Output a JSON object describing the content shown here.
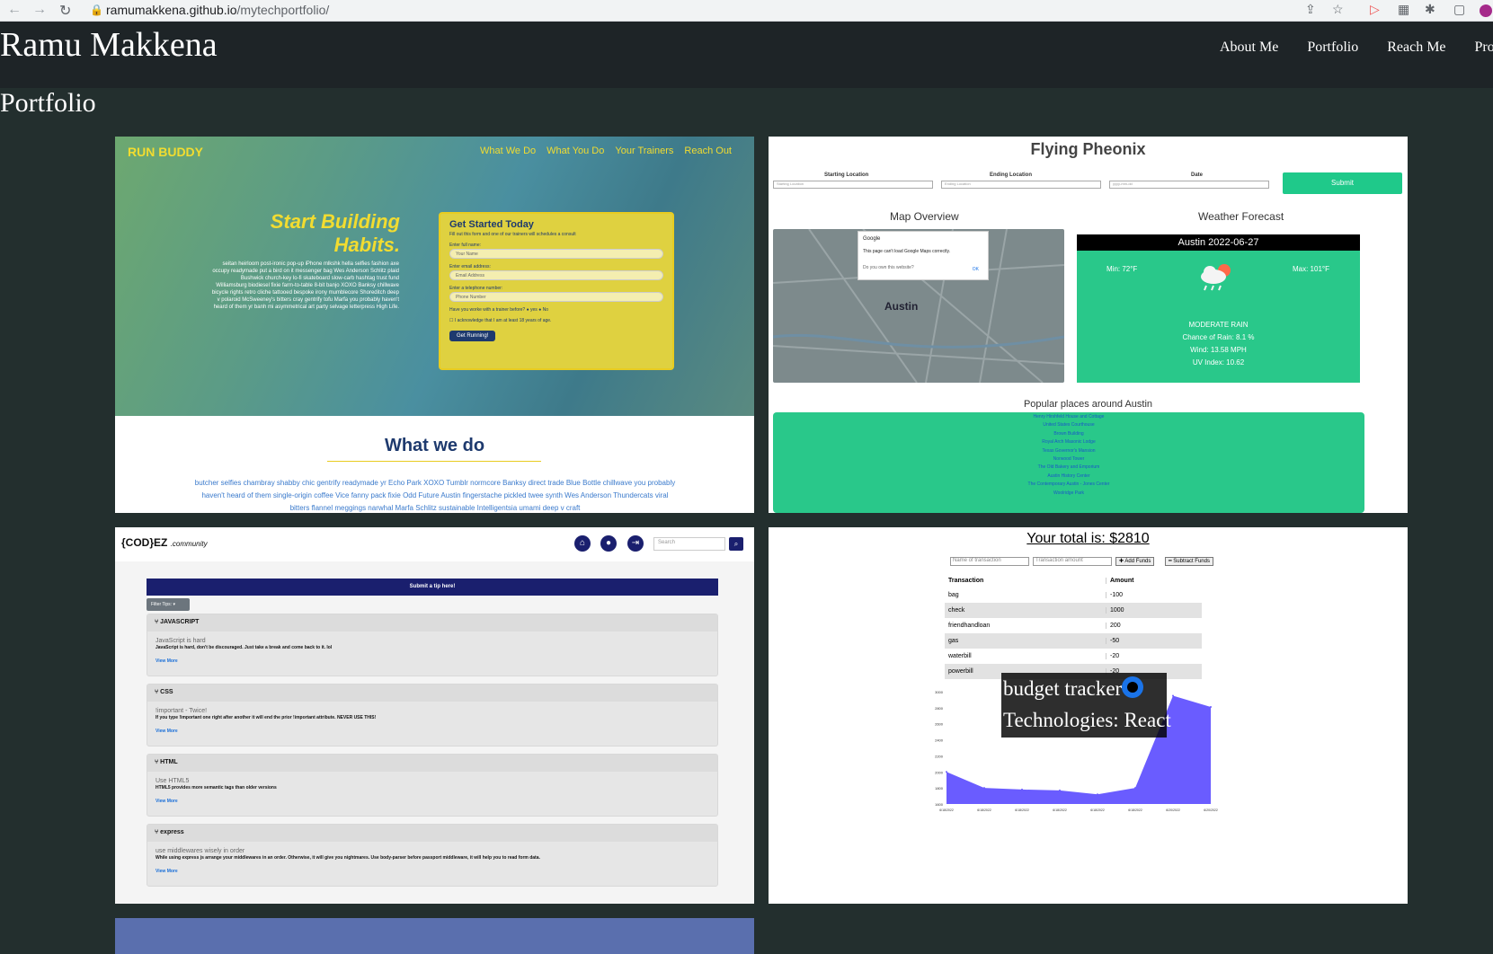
{
  "browser": {
    "url_host": "ramumakkena.github.io",
    "url_path": "/mytechportfolio/"
  },
  "header": {
    "brand": "Ramu Makkena",
    "nav": [
      "About Me",
      "Portfolio",
      "Reach Me",
      "Pro"
    ]
  },
  "section_title": "Portfolio",
  "run_buddy": {
    "logo": "RUN BUDDY",
    "nav": [
      "What We Do",
      "What You Do",
      "Your Trainers",
      "Reach Out"
    ],
    "hero_title_1": "Start Building",
    "hero_title_2": "Habits.",
    "hero_text": "seitan heirloom post-ironic pop-up iPhone mlkshk hella selfies fashion axe occupy readymade put a bird on it messenger bag Wes Anderson Schlitz plaid Bushwick church-key lo-fi skateboard slow-carb hashtag trust fund Williamsburg biodiesel fixie farm-to-table 8-bit banjo XOXO Banksy chillwave bicycle rights retro cliche tattooed bespoke irony mumblecore Shoreditch deep v polaroid McSweeney's bitters cray gentrify tofu Marfa you probably haven't heard of them yr banh mi asymmetrical art party selvage letterpress High Life.",
    "form_title": "Get Started Today",
    "form_sub": "Fill out this form and one of our trainers will schedules a consult",
    "label_name": "Enter full name:",
    "ph_name": "Your Name",
    "label_email": "Enter email address:",
    "ph_email": "Email Address",
    "label_phone": "Enter a telephone number:",
    "ph_phone": "Phone Number",
    "worked": "Have you worke with a trainer before?",
    "yes": "yes",
    "no": "No",
    "ack": "I acknowledge that I am at least 18 years of age.",
    "button": "Get Running!",
    "what_we_do": "What we do",
    "wwd_text": "butcher selfies chambray shabby chic gentrify readymade yr Echo Park XOXO Tumblr normcore Banksy direct trade Blue Bottle chillwave you probably haven't heard of them single-origin coffee Vice fanny pack fixie Odd Future Austin fingerstache pickled twee synth Wes Anderson Thundercats viral bitters flannel meggings narwhal Marfa Schlitz sustainable Intelligentsia umami deep v craft"
  },
  "flying_pheonix": {
    "title": "Flying Pheonix",
    "label_start": "Starting Location",
    "label_end": "Ending Location",
    "label_date": "Date",
    "ph_start": "Starting Location",
    "ph_end": "Ending Location",
    "ph_date": "yyyy-mm-dd",
    "submit": "Submit",
    "map_title": "Map Overview",
    "weather_title": "Weather Forecast",
    "map_city": "Austin",
    "dialog_brand": "Google",
    "dialog_msg": "This page can't load Google Maps correctly.",
    "dialog_q": "Do you own this website?",
    "dialog_ok": "OK",
    "weather_header": "Austin 2022-06-27",
    "min": "Min: 72°F",
    "max": "Max: 101°F",
    "condition": "MODERATE RAIN",
    "rain": "Chance of Rain: 8.1 %",
    "wind": "Wind: 13.58 MPH",
    "uv": "UV Index: 10.62",
    "popular_title": "Popular places around Austin",
    "places": [
      "Henry Hirshfeld House and Cottage",
      "United States Courthouse",
      "Brown Building",
      "Royal Arch Masonic Lodge",
      "Texas Governor's Mansion",
      "Norwood Tower",
      "The Old Bakery and Emporium",
      "Austin History Center",
      "The Contemporary Austin - Jones Center",
      "Woolridge Park"
    ]
  },
  "codez": {
    "logo": "{COD}EZ",
    "logo_small": ".community",
    "search_ph": "Search",
    "submit": "Submit a tip here!",
    "filter": "Filter Tips: ▾",
    "view_more": "View More",
    "tips": [
      {
        "cat": "JAVASCRIPT",
        "title": "JavaScript is hard",
        "body": "JavaScript is hard, don't be discouraged. Just take a break and come back to it. lol"
      },
      {
        "cat": "CSS",
        "title": "!important - Twice!",
        "body": "If you type !important one right after another it will end the prior !important attribute. NEVER USE THIS!"
      },
      {
        "cat": "HTML",
        "title": "Use HTML5",
        "body": "HTML5 provides more semantic tags than older versions"
      },
      {
        "cat": "express",
        "title": "use middlewares wisely in order",
        "body": "While using express js arrange your middlewares in an order. Otherwise, it will give you nightmares. Use body-parser before passport middleware, it will help you to read form data."
      }
    ]
  },
  "budget": {
    "total": "Your total is: $2810",
    "ph_name": "Name of transaction",
    "ph_amount": "Transaction amount",
    "add": "✚ Add Funds",
    "subtract": "━ Subtract Funds",
    "col_tx": "Transaction",
    "col_amount": "Amount",
    "rows": [
      {
        "t": "bag",
        "a": "-100"
      },
      {
        "t": "check",
        "a": "1000"
      },
      {
        "t": "friendhandloan",
        "a": "200"
      },
      {
        "t": "gas",
        "a": "-50"
      },
      {
        "t": "waterbill",
        "a": "-20"
      },
      {
        "t": "powerbill",
        "a": "-20"
      }
    ],
    "overlay_title": "budget tracker",
    "overlay_tech": "Technologies: React",
    "y_ticks": [
      "3000",
      "2800",
      "2600",
      "2400",
      "2200",
      "2000",
      "1800",
      "1600"
    ],
    "x_ticks": [
      "6/18/2022",
      "6/18/2022",
      "6/18/2022",
      "6/18/2022",
      "6/18/2022",
      "6/18/2022",
      "6/20/2022",
      "6/20/2022"
    ]
  },
  "chart_data": {
    "type": "area",
    "x": [
      "6/18/2022",
      "6/18/2022",
      "6/18/2022",
      "6/18/2022",
      "6/18/2022",
      "6/18/2022",
      "6/20/2022",
      "6/20/2022"
    ],
    "values": [
      2000,
      1800,
      1780,
      1770,
      1720,
      1800,
      2950,
      2810
    ],
    "ylim": [
      1600,
      3000
    ],
    "color": "#6a5cff"
  }
}
